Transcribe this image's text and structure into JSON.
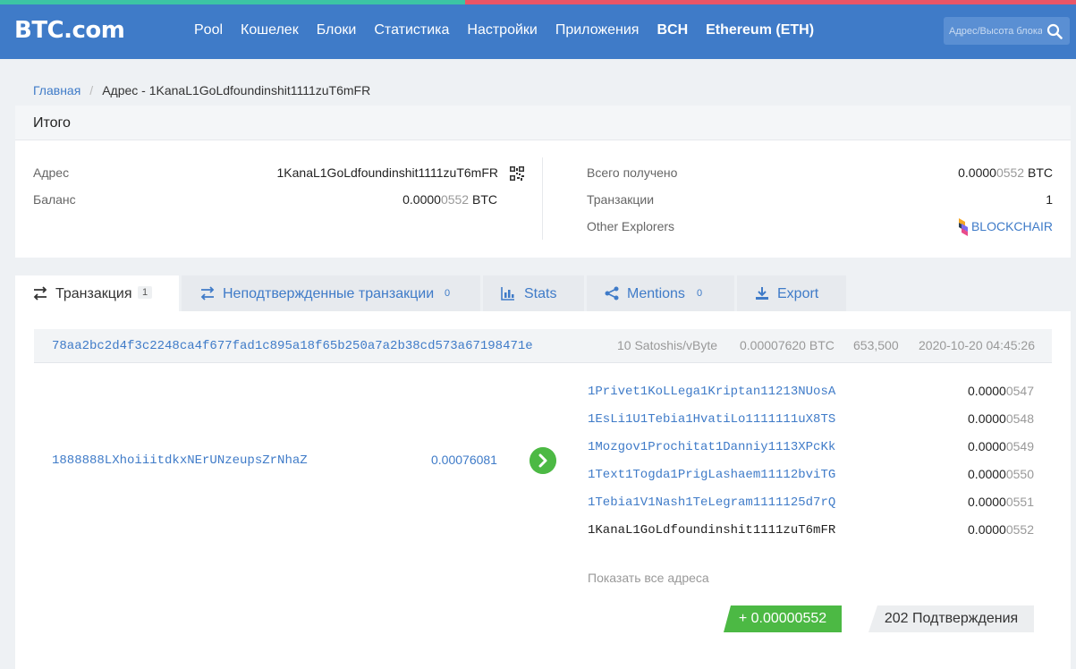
{
  "header": {
    "logo": "BTC.com",
    "nav": [
      "Pool",
      "Кошелек",
      "Блоки",
      "Статистика",
      "Настройки",
      "Приложения",
      "BCH",
      "Ethereum (ETH)"
    ],
    "search_placeholder": "Адрес/Высота блока",
    "colors": {
      "header_bg": "#3f7bc8",
      "stripe_left": "#3cc4a4",
      "stripe_right": "#ea5566"
    }
  },
  "breadcrumb": {
    "home": "Главная",
    "current": "Адрес - 1KanaL1GoLdfoundinshit1111zuT6mFR"
  },
  "summary": {
    "title": "Итого",
    "address_label": "Адрес",
    "address_value": "1KanaL1GoLdfoundinshit1111zuT6mFR",
    "balance_label": "Баланс",
    "balance_main": "0.0000",
    "balance_rest": "0552",
    "balance_unit": " BTC",
    "received_label": "Всего получено",
    "received_main": "0.0000",
    "received_rest": "0552",
    "received_unit": " BTC",
    "tx_label": "Транзакции",
    "tx_value": "1",
    "explorers_label": "Other Explorers",
    "explorers_value": "BLOCKCHAIR"
  },
  "tabs": [
    {
      "label": "Транзакция",
      "count": "1",
      "icon": "swap-icon"
    },
    {
      "label": "Неподтвержденные транзакции",
      "count": "0",
      "icon": "swap-icon"
    },
    {
      "label": "Stats",
      "count": "",
      "icon": "bar-chart-icon"
    },
    {
      "label": "Mentions",
      "count": "0",
      "icon": "share-icon"
    },
    {
      "label": "Export",
      "count": "",
      "icon": "download-icon"
    }
  ],
  "transaction": {
    "hash": "78aa2bc2d4f3c2248ca4f677fad1c895a18f65b250a7a2b38cd573a67198471e",
    "fee_rate": "10 Satoshis/vByte",
    "fee": "0.00007620 BTC",
    "block": "653,500",
    "time": "2020-10-20 04:45:26",
    "input_address": "1888888LXhoiiitdkxNErUNzeupsZrNhaZ",
    "input_amount": "0.00076081",
    "outputs": [
      {
        "address": "1Privet1KoLLega1Kriptan11213NUosA",
        "main": "0.0000",
        "rest": "0547"
      },
      {
        "address": "1EsLi1U1Tebia1HvatiLo1111111uX8TS",
        "main": "0.0000",
        "rest": "0548"
      },
      {
        "address": "1Mozgov1Prochitat1Danniy1113XPcKk",
        "main": "0.0000",
        "rest": "0549"
      },
      {
        "address": "1Text1Togda1PrigLashaem11112bviTG",
        "main": "0.0000",
        "rest": "0550"
      },
      {
        "address": "1Tebia1V1Nash1TeLegram1111125d7rQ",
        "main": "0.0000",
        "rest": "0551"
      },
      {
        "address": "1KanaL1GoLdfoundinshit1111zuT6mFR",
        "main": "0.0000",
        "rest": "0552"
      }
    ],
    "show_all": "Показать все адреса",
    "net_change": "+ 0.00000552",
    "confirmations": "202 Подтверждения",
    "colors": {
      "positive": "#4cb944"
    }
  }
}
